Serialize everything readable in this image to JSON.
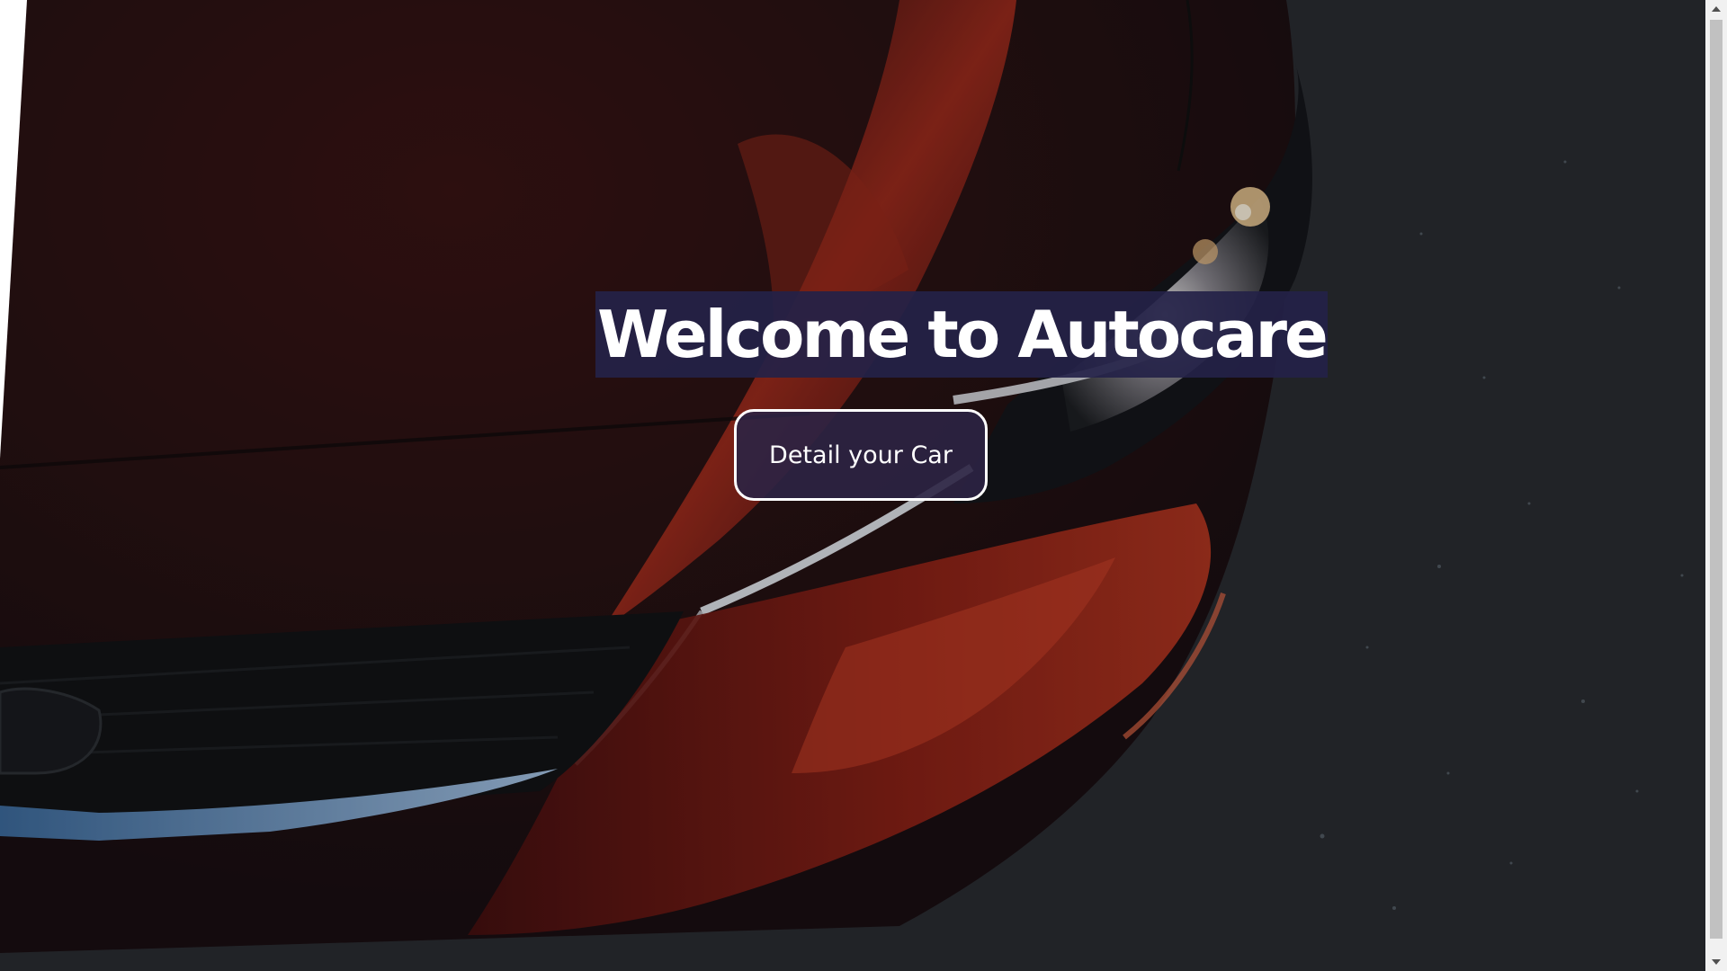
{
  "hero": {
    "headline": "Welcome to Autocare",
    "cta_label": "Detail your Car",
    "image_icon": "car-headlight-photo"
  },
  "scrollbar": {
    "up_icon": "triangle-up-icon",
    "down_icon": "triangle-down-icon"
  },
  "colors": {
    "headline_highlight": "#242248",
    "button_fill": "#2c2444",
    "button_border": "#ffffff",
    "car_red": "#8e1e1a",
    "asphalt": "#2a2c33"
  }
}
